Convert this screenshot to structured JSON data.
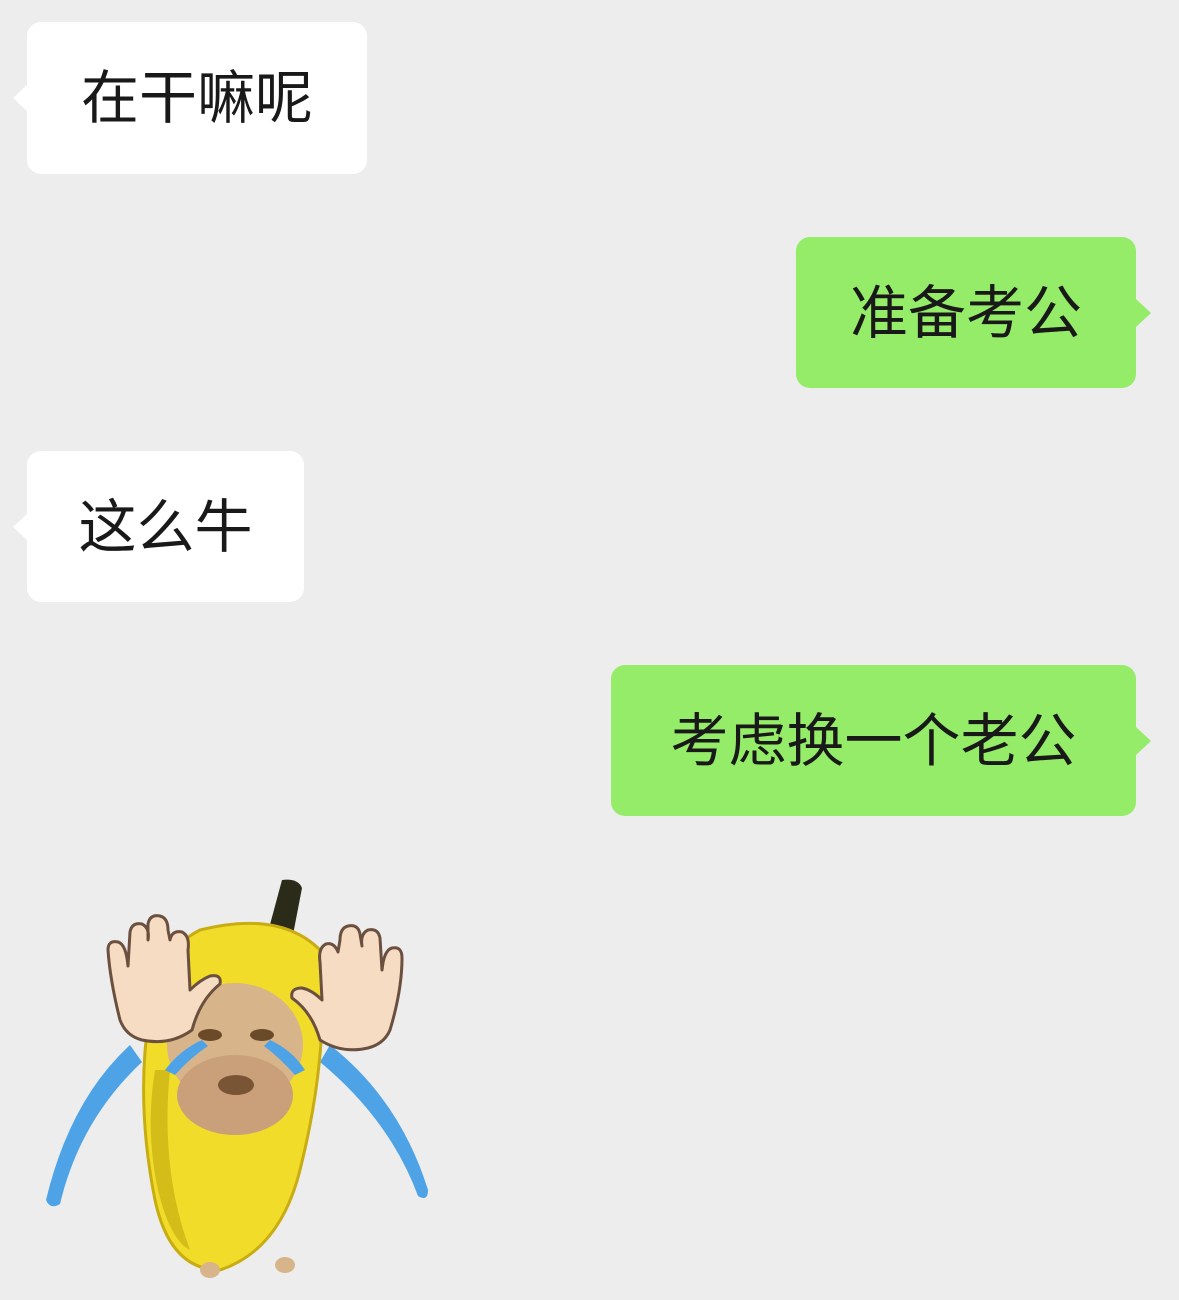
{
  "messages": [
    {
      "side": "incoming",
      "text": "在干嘛呢"
    },
    {
      "side": "outgoing",
      "text": "准备考公"
    },
    {
      "side": "incoming",
      "text": "这么牛"
    },
    {
      "side": "outgoing",
      "text": "考虑换一个老公"
    }
  ],
  "sticker": {
    "icon": "crying-banana-cat-sticker-icon"
  },
  "colors": {
    "background": "#ededed",
    "incoming_bubble": "#ffffff",
    "outgoing_bubble": "#95ec69",
    "text": "#191919"
  }
}
